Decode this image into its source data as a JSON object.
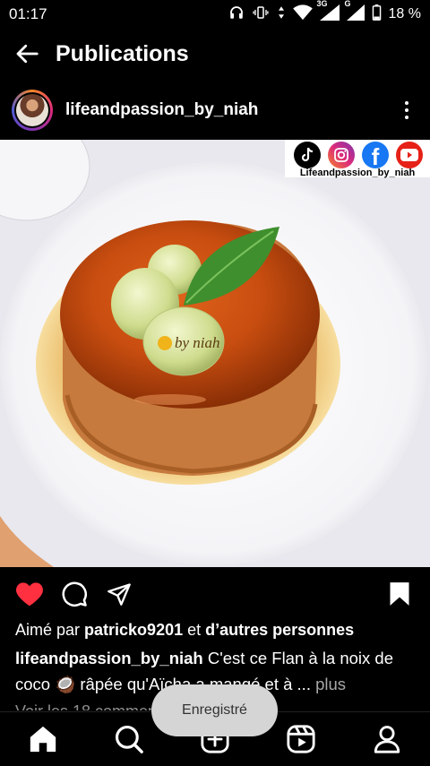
{
  "status_bar": {
    "time": "01:17",
    "network": "3G",
    "network_sub": "G",
    "battery": "18 %"
  },
  "header": {
    "title": "Publications"
  },
  "post": {
    "username": "lifeandpassion_by_niah",
    "watermark_handle": "Lifeandpassion_by_niah",
    "image_stamp": "by niah"
  },
  "likes": {
    "prefix": "Aimé par ",
    "user": "patricko9201",
    "middle": " et ",
    "others": "d’autres personnes"
  },
  "caption": {
    "username": "lifeandpassion_by_niah",
    "text": " C'est ce Flan à la noix de coco 🥥 râpée qu'Aïcha a mangé et à ... ",
    "more": "plus"
  },
  "comments": {
    "label": "Voir les 18 commentaires"
  },
  "toast": {
    "label": "Enregistré"
  },
  "colors": {
    "like_red": "#ff3040",
    "background": "#000000",
    "toast_bg": "#d5d5d5"
  }
}
